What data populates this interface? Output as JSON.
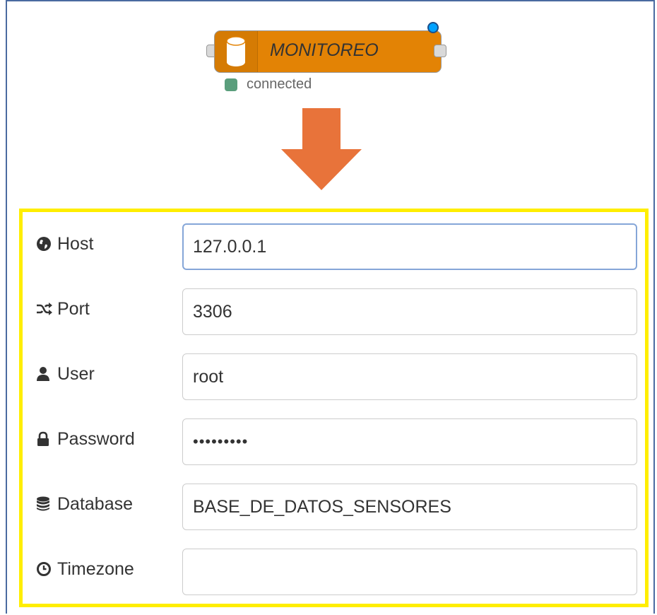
{
  "node": {
    "label": "MONITOREO",
    "color": "#e38305",
    "icon": "database-icon",
    "status": {
      "text": "connected",
      "color": "#5a9e7c"
    }
  },
  "arrow": {
    "color": "#e8733a"
  },
  "highlight_color": "#ffee00",
  "form": {
    "host": {
      "label": "Host",
      "icon": "globe-icon",
      "value": "127.0.0.1"
    },
    "port": {
      "label": "Port",
      "icon": "shuffle-icon",
      "value": "3306"
    },
    "user": {
      "label": "User",
      "icon": "user-icon",
      "value": "root"
    },
    "password": {
      "label": "Password",
      "icon": "lock-icon",
      "value": "•••••••••"
    },
    "database": {
      "label": "Database",
      "icon": "database-icon",
      "value": "BASE_DE_DATOS_SENSORES"
    },
    "timezone": {
      "label": "Timezone",
      "icon": "clock-icon",
      "value": ""
    }
  }
}
